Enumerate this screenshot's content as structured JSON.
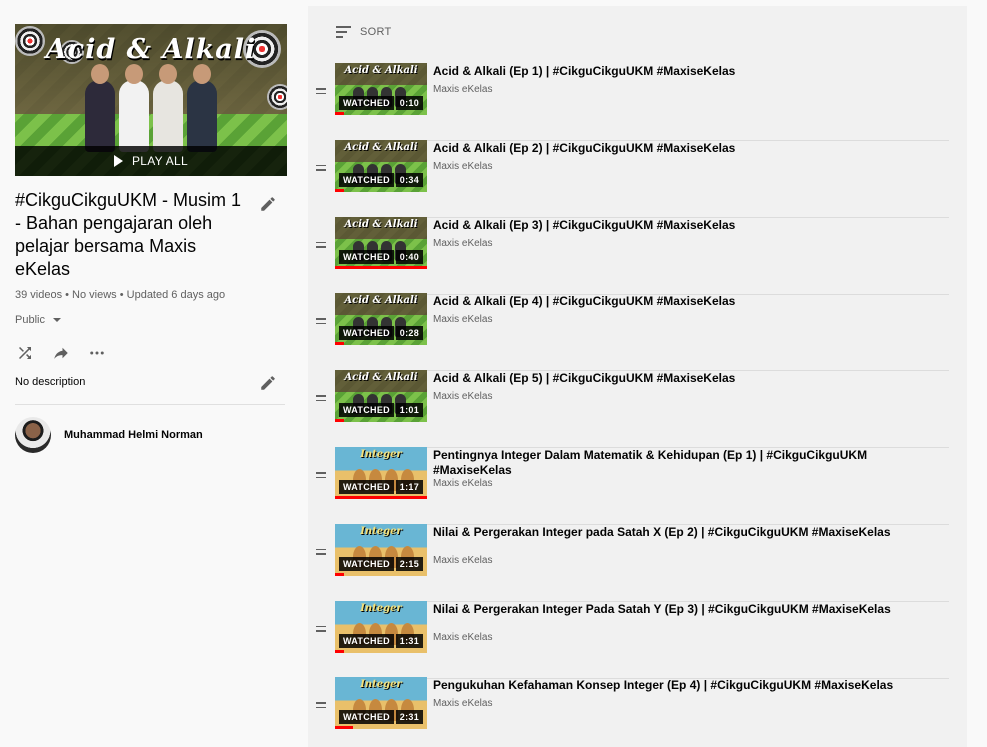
{
  "playlist": {
    "hero_title": "Acid & Alkali",
    "play_all_label": "PLAY ALL",
    "title": "#CikguCikguUKM - Musim 1 - Bahan pengajaran oleh pelajar bersama Maxis eKelas",
    "meta": "39 videos • No views • Updated 6 days ago",
    "privacy": "Public",
    "description": "No description",
    "owner": "Muhammad Helmi Norman"
  },
  "icons": {
    "shuffle": "shuffle-icon",
    "share": "share-icon",
    "more": "more-horiz-icon",
    "edit": "pencil-icon",
    "sort": "sort-icon",
    "drag": "drag-handle-icon",
    "play": "play-icon"
  },
  "list": {
    "sort_label": "SORT",
    "watched_label": "WATCHED",
    "items": [
      {
        "title": "Acid & Alkali (Ep 1) | #CikguCikguUKM #MaxiseKelas",
        "channel": "Maxis eKelas",
        "duration": "0:10",
        "thumb": "acid",
        "thumb_text": "Acid & Alkali",
        "progress": 0.1
      },
      {
        "title": "Acid & Alkali (Ep 2) | #CikguCikguUKM #MaxiseKelas",
        "channel": "Maxis eKelas",
        "duration": "0:34",
        "thumb": "acid",
        "thumb_text": "Acid & Alkali",
        "progress": 0.1
      },
      {
        "title": "Acid & Alkali (Ep 3) | #CikguCikguUKM #MaxiseKelas",
        "channel": "Maxis eKelas",
        "duration": "0:40",
        "thumb": "acid",
        "thumb_text": "Acid & Alkali",
        "progress": 1.0
      },
      {
        "title": "Acid & Alkali (Ep 4) | #CikguCikguUKM #MaxiseKelas",
        "channel": "Maxis eKelas",
        "duration": "0:28",
        "thumb": "acid",
        "thumb_text": "Acid & Alkali",
        "progress": 0.1
      },
      {
        "title": "Acid & Alkali (Ep 5) | #CikguCikguUKM #MaxiseKelas",
        "channel": "Maxis eKelas",
        "duration": "1:01",
        "thumb": "acid",
        "thumb_text": "Acid & Alkali",
        "progress": 0.1
      },
      {
        "title": "Pentingnya Integer Dalam Matematik & Kehidupan (Ep 1) | #CikguCikguUKM #MaxiseKelas",
        "channel": "Maxis eKelas",
        "duration": "1:17",
        "thumb": "integer",
        "thumb_text": "Integer",
        "progress": 1.0
      },
      {
        "title": "Nilai & Pergerakan Integer pada Satah X (Ep 2) | #CikguCikguUKM #MaxiseKelas",
        "channel": "Maxis eKelas",
        "duration": "2:15",
        "thumb": "integer",
        "thumb_text": "Integer",
        "progress": 0.1
      },
      {
        "title": "Nilai & Pergerakan Integer Pada Satah Y (Ep 3) | #CikguCikguUKM #MaxiseKelas",
        "channel": "Maxis eKelas",
        "duration": "1:31",
        "thumb": "integer",
        "thumb_text": "Integer",
        "progress": 0.1
      },
      {
        "title": "Pengukuhan Kefahaman Konsep Integer (Ep 4) | #CikguCikguUKM #MaxiseKelas",
        "channel": "Maxis eKelas",
        "duration": "2:31",
        "thumb": "integer",
        "thumb_text": "Integer",
        "progress": 0.2
      }
    ]
  },
  "colors": {
    "progress": "#ff0000",
    "sidebar_bg": "#f9f9f9",
    "list_bg": "#f1f1f1"
  }
}
